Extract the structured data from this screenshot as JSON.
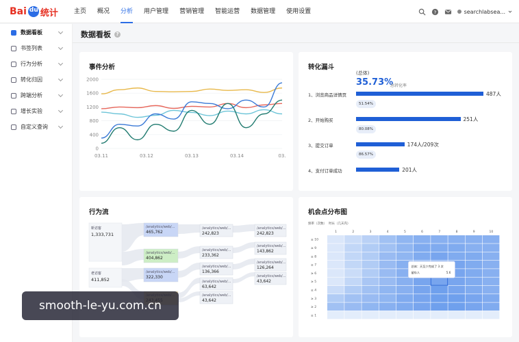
{
  "header": {
    "logo_text_left": "Bai",
    "logo_text_right": "统计",
    "nav": [
      "主页",
      "概况",
      "分析",
      "用户管理",
      "营销管理",
      "智能运营",
      "数据管理",
      "使用设置"
    ],
    "active_nav_index": 2,
    "user": "searchlabsea..."
  },
  "sidebar": {
    "items": [
      "数据看板",
      "书签列表",
      "行为分析",
      "转化归因",
      "跨端分析",
      "增长实验",
      "自定义查询"
    ],
    "active_index": 0
  },
  "page": {
    "title": "数据看板"
  },
  "event_card": {
    "title": "事件分析",
    "chart_data": {
      "type": "line",
      "x": [
        "03.11",
        "03.12",
        "03.13",
        "03.14",
        "03.15"
      ],
      "x_tick_labels": [
        "03.11",
        "03.12",
        "03.13",
        "03.14",
        "03."
      ],
      "ylim": [
        0,
        2000
      ],
      "y_ticks": [
        0,
        400,
        800,
        1200,
        1600,
        2000
      ],
      "series": [
        {
          "color": "#e8b84a",
          "values": [
            1580,
            1700,
            1750,
            1650,
            1640,
            1650,
            1720,
            1680,
            1700,
            1620,
            1750
          ]
        },
        {
          "color": "#e8665a",
          "values": [
            1150,
            1200,
            1180,
            1240,
            1160,
            1220,
            1200,
            1300,
            1180,
            1260,
            1300
          ]
        },
        {
          "color": "#6cc4d8",
          "values": [
            1050,
            1000,
            900,
            960,
            1100,
            1040,
            950,
            1080,
            1000,
            1120,
            1000
          ]
        },
        {
          "color": "#3a79d6",
          "values": [
            300,
            700,
            650,
            1000,
            850,
            1350,
            1300,
            1150,
            1400,
            1200,
            1900
          ]
        },
        {
          "color": "#1f7a6f",
          "values": [
            150,
            600,
            250,
            700,
            500,
            1100,
            700,
            1300,
            600,
            1000,
            1400
          ]
        }
      ]
    }
  },
  "funnel_card": {
    "title": "转化漏斗",
    "total_label": "(总体)",
    "total_rate": "35.73%",
    "total_rate_caption": "总转化率",
    "steps": [
      {
        "label": "1、浏览商品详情页",
        "value": "487人",
        "fraction": 1.0,
        "rate": "51.54%"
      },
      {
        "label": "2、开始购买",
        "value": "251人",
        "fraction": 0.82,
        "rate": "80.08%"
      },
      {
        "label": "3、提交订单",
        "value": "174人/209次",
        "fraction": 0.38,
        "rate": "86.57%"
      },
      {
        "label": "4、支付订单成功",
        "value": "201人",
        "fraction": 0.34,
        "rate": ""
      }
    ]
  },
  "flow_card": {
    "title": "行为流",
    "col1": [
      {
        "label": "新访客",
        "value": "1,333,731"
      },
      {
        "label": "老访客",
        "value": "411,852"
      }
    ],
    "col2": [
      {
        "label": "/analytics/web/...",
        "value": "465,762",
        "color": "#c8d6f6"
      },
      {
        "label": "/analytics/web/...",
        "value": "404,862",
        "color": "#cdeec5"
      },
      {
        "label": "/analytics/web/...",
        "value": "322,330",
        "color": "#c8d6f6"
      },
      {
        "label": "/analytics/web/...",
        "value": "243,455",
        "color": "#f2dca4"
      }
    ],
    "col3": [
      {
        "label": "/analytics/web/...",
        "value": "242,823"
      },
      {
        "label": "/analytics/web/...",
        "value": "233,362"
      },
      {
        "label": "/analytics/web/...",
        "value": "136,366"
      },
      {
        "label": "/analytics/web/...",
        "value": "63,642"
      },
      {
        "label": "/analytics/web/...",
        "value": "43,642"
      }
    ],
    "col4": [
      {
        "label": "/analytics/web/...",
        "value": "242,823"
      },
      {
        "label": "/analytics/web/...",
        "value": "143,862"
      },
      {
        "label": "/analytics/web/...",
        "value": "126,264"
      },
      {
        "label": "/analytics/web/...",
        "value": "43,642"
      }
    ]
  },
  "opportunity_card": {
    "title": "机会点分布图",
    "x_header": [
      "1",
      "2",
      "3",
      "4",
      "5",
      "6",
      "7",
      "8",
      "9",
      "10"
    ],
    "y_header": [
      "≥ 10",
      "≥ 9",
      "≥ 8",
      "≥ 7",
      "≥ 6",
      "≥ 5",
      "≥ 4",
      "≥ 3",
      "≥ 2",
      "≥ 1"
    ],
    "corner_labels": [
      "频率（次数）",
      "时长（几天内）"
    ],
    "tooltip_line1": "总体：天至少完成了 3 次",
    "tooltip_line2_label": "留存人",
    "tooltip_line2_value": "5.6",
    "chart_data": {
      "type": "heatmap",
      "rows": [
        [
          0.1,
          0.2,
          0.3,
          0.45,
          0.55,
          0.6,
          0.6,
          0.6,
          0.6,
          0.6
        ],
        [
          0.1,
          0.25,
          0.35,
          0.45,
          0.55,
          0.65,
          0.65,
          0.65,
          0.6,
          0.6
        ],
        [
          0.1,
          0.25,
          0.35,
          0.5,
          0.55,
          0.65,
          0.7,
          0.65,
          0.65,
          0.6
        ],
        [
          0.1,
          0.25,
          0.35,
          0.5,
          0.6,
          0.65,
          0.7,
          0.7,
          0.65,
          0.6
        ],
        [
          0.1,
          0.2,
          0.35,
          0.5,
          0.6,
          0.7,
          0.8,
          0.7,
          0.65,
          0.6
        ],
        [
          0.1,
          0.25,
          0.4,
          0.5,
          0.6,
          0.7,
          0.7,
          0.7,
          0.65,
          0.6
        ],
        [
          0.2,
          0.35,
          0.45,
          0.55,
          0.6,
          0.7,
          0.75,
          0.7,
          0.65,
          0.6
        ],
        [
          0.35,
          0.45,
          0.5,
          0.55,
          0.65,
          0.7,
          0.75,
          0.75,
          0.7,
          0.65
        ],
        [
          0.45,
          0.5,
          0.55,
          0.6,
          0.65,
          0.7,
          0.75,
          0.75,
          0.7,
          0.65
        ],
        [
          0.05,
          0.05,
          0.05,
          0.05,
          0.05,
          0.05,
          0.05,
          0.05,
          0.05,
          0.05
        ]
      ]
    }
  },
  "watermark": "smooth-le-yu.com.cn"
}
